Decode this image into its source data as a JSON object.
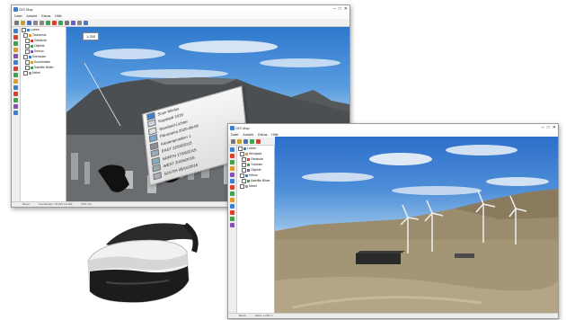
{
  "win1": {
    "title": "GIS Map",
    "menu": [
      "Datei",
      "Ansicht",
      "Extras",
      "Hilfe"
    ],
    "tree": [
      "Luxem",
      "Tourismus",
      "Gebäude",
      "Objekte",
      "Sensor",
      "Szenarien",
      "Koordinaten",
      "Satellite Bilder",
      "Nebel"
    ],
    "scale_label": "1:250",
    "vr_panel_rows": [
      "Scan Modus",
      "Kapstadt 2019",
      "Standard-Lichter",
      "Panorama 2020-08-06",
      "Kameraposition 1",
      "EAST     22/06/2015",
      "NORTH   17/06/2015",
      "WEST    20/06/2016",
      "SOUTH   08/10/2016",
      "NADIR"
    ],
    "status": [
      "Bereit",
      "Koordinaten: 33.91S 18.42E",
      "FPS: 60"
    ]
  },
  "win2": {
    "title": "GIS Map",
    "menu": [
      "Datei",
      "Ansicht",
      "Extras",
      "Hilfe"
    ],
    "tree": [
      "Luxem",
      "Windpark",
      "Gebäude",
      "Turbinen",
      "Objekte",
      "Höhen",
      "Satellite Bilder",
      "Nebel"
    ],
    "status": [
      "Bereit",
      "Höhe: 1.245 m"
    ]
  },
  "colors": {
    "accent": "#3a7fd0",
    "toolbar_green": "#3fa34d",
    "toolbar_red": "#d9412f"
  }
}
